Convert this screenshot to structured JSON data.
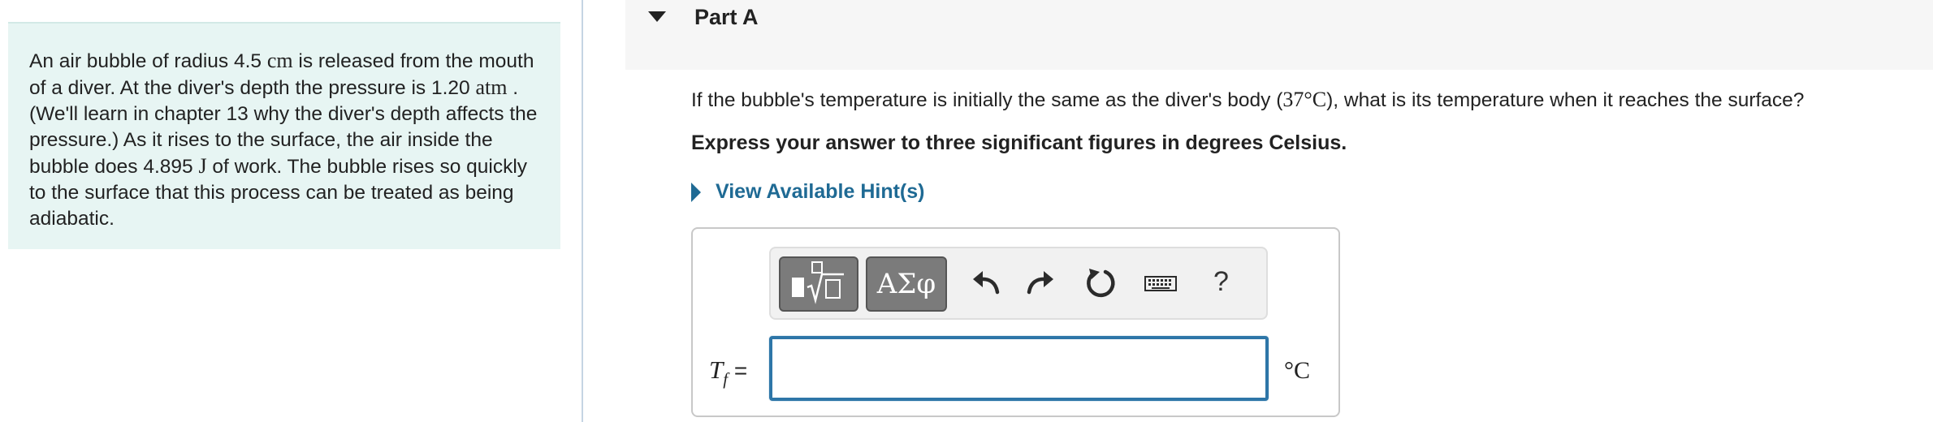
{
  "problem": {
    "seg1": "An air bubble of radius 4.5 ",
    "unit_cm": "cm",
    "seg2": " is released from the mouth of a diver. At the diver's depth the pressure is 1.20 ",
    "unit_atm": "atm",
    "seg3": " . (We'll learn in chapter 13 why the diver's depth affects the pressure.) As it rises to the surface, the air inside the bubble does 4.895 ",
    "unit_j": "J",
    "seg4": "  of work. The bubble rises so quickly to the surface that this process can be treated as being adiabatic."
  },
  "part": {
    "title": "Part A"
  },
  "question": {
    "text_a": "If the bubble's temperature is initially the same as the diver's body (",
    "temp": "37°C",
    "text_b": "), what is its temperature when it reaches the surface?"
  },
  "instruction": "Express your answer to three significant figures in degrees Celsius.",
  "hint": {
    "label": "View Available Hint(s)"
  },
  "toolbar": {
    "greek_label": "ΑΣφ",
    "help_label": "?",
    "icons": [
      "templates-icon",
      "undo-icon",
      "redo-icon",
      "reset-icon",
      "keyboard-icon",
      "help-icon"
    ]
  },
  "answer": {
    "variable": "T",
    "subscript": "f",
    "equals": " =",
    "value": "",
    "unit": "°C"
  },
  "colors": {
    "accent": "#1f6a94",
    "input_border": "#2e76a8",
    "panel_bg": "#e7f5f3",
    "toolbar_button": "#7b7b7b"
  }
}
